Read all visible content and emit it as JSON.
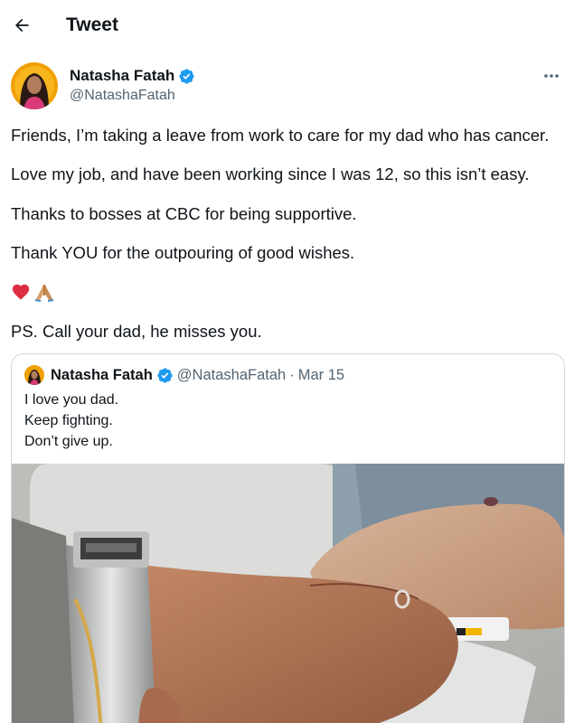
{
  "header": {
    "back_icon": "arrow-left-icon",
    "title": "Tweet"
  },
  "author": {
    "name": "Natasha Fatah",
    "handle": "@NatashaFatah",
    "verified_icon": "verified-badge-icon",
    "more_icon": "more-horizontal-icon"
  },
  "tweet": {
    "lines": [
      "Friends, I’m taking a leave from work to care for my dad who has cancer.",
      "Love my job, and have been working since I was 12, so this isn’t easy.",
      "Thanks to bosses at CBC for being supportive.",
      "Thank YOU for the outpouring of good wishes.",
      "PS. Call your dad, he misses you."
    ],
    "emojis": [
      "heart-icon",
      "folded-hands-icon"
    ]
  },
  "quoted_tweet": {
    "name": "Natasha Fatah",
    "handle": "@NatashaFatah",
    "separator": "·",
    "date": "Mar 15",
    "lines": [
      "I love you dad.",
      "Keep fighting.",
      "Don’t give up."
    ],
    "photo": "holding-hands-photo"
  },
  "colors": {
    "text": "#0f1419",
    "secondary_text": "#536471",
    "border": "#cfd9de",
    "verified_blue": "#1d9bf0"
  }
}
